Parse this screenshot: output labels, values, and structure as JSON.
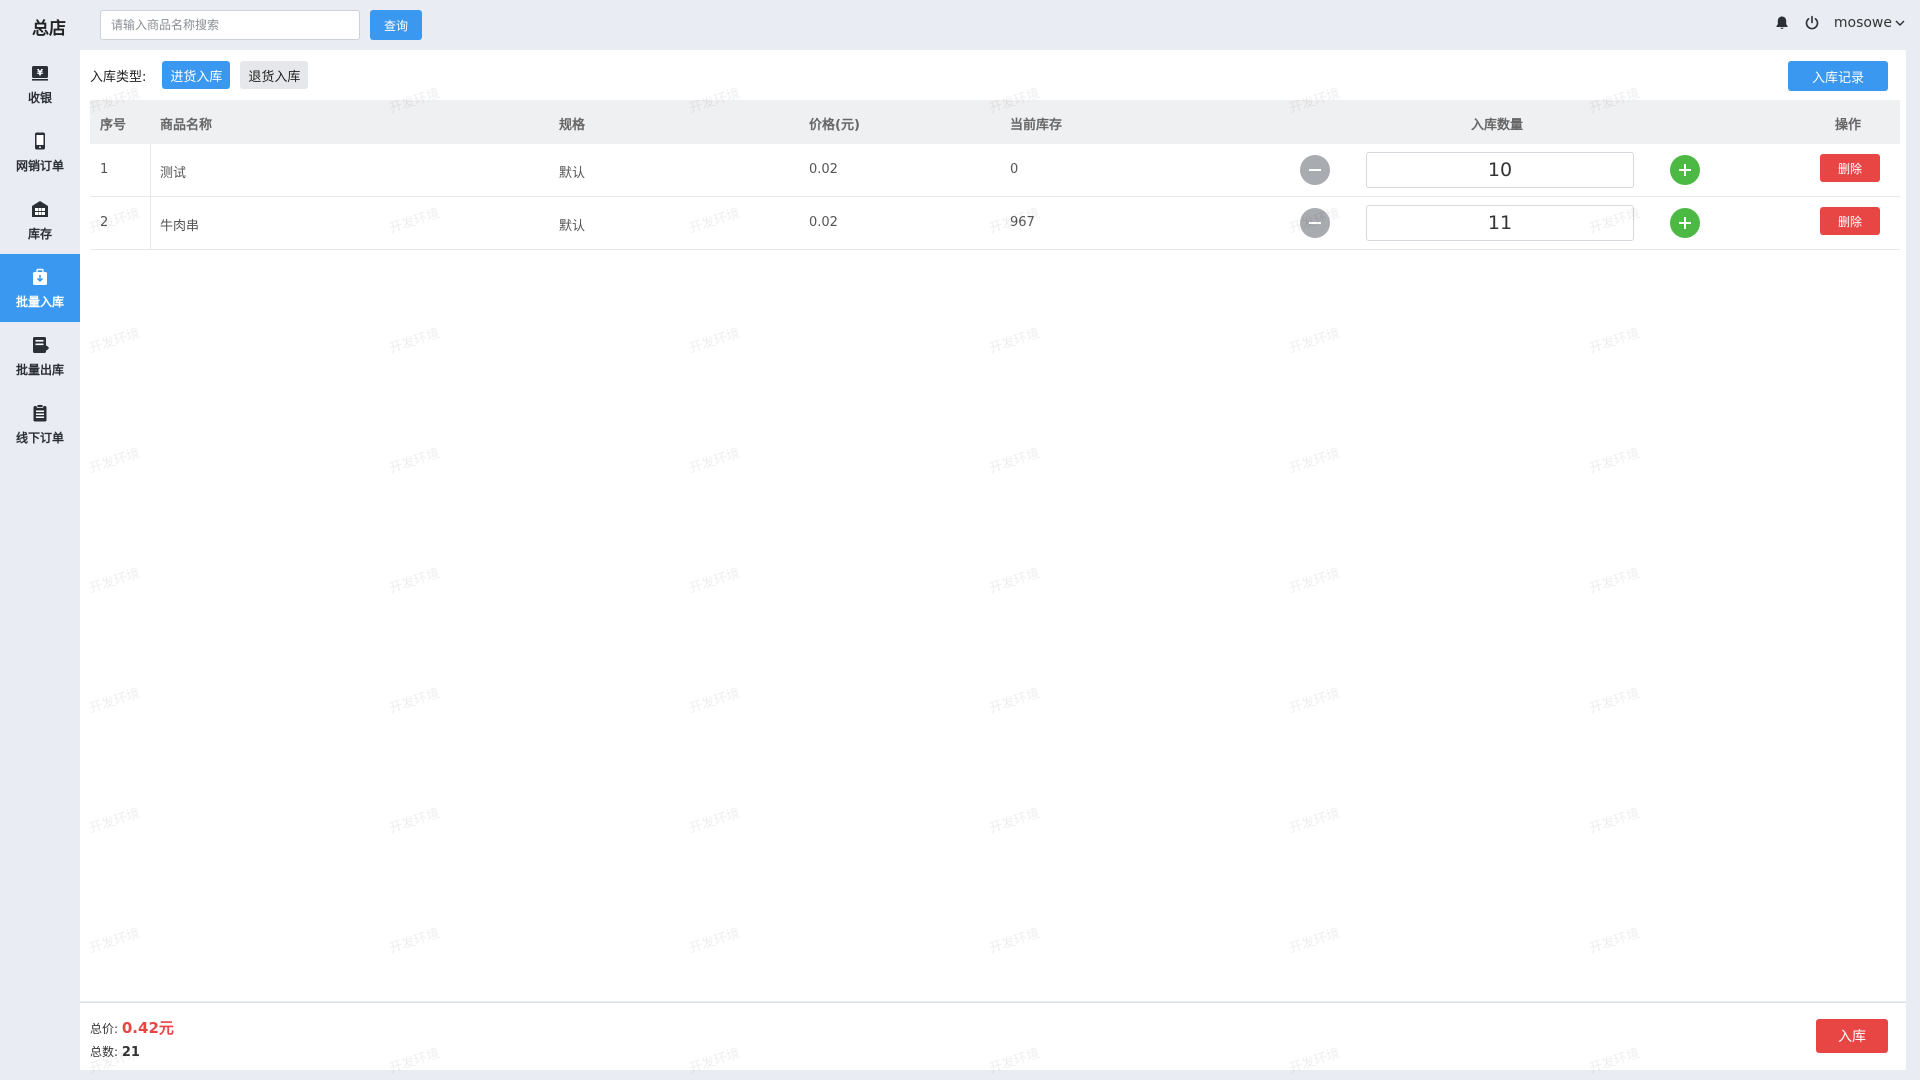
{
  "header": {
    "store_name": "总店",
    "search_placeholder": "请输入商品名称搜索",
    "search_button": "查询",
    "username": "mosowe"
  },
  "sidebar": {
    "items": [
      {
        "label": "收银",
        "icon": "yen-icon"
      },
      {
        "label": "网销订单",
        "icon": "phone-icon"
      },
      {
        "label": "库存",
        "icon": "warehouse-icon"
      },
      {
        "label": "批量入库",
        "icon": "box-in-icon",
        "active": true
      },
      {
        "label": "批量出库",
        "icon": "box-out-icon"
      },
      {
        "label": "线下订单",
        "icon": "clipboard-icon"
      }
    ]
  },
  "toolbar": {
    "type_label": "入库类型:",
    "type_purchase": "进货入库",
    "type_return": "退货入库",
    "record_button": "入库记录"
  },
  "table": {
    "columns": [
      "序号",
      "商品名称",
      "规格",
      "价格(元)",
      "当前库存",
      "入库数量",
      "操作"
    ],
    "rows": [
      {
        "index": "1",
        "name": "测试",
        "spec": "默认",
        "price": "0.02",
        "stock": "0",
        "quantity": "10",
        "action": "删除"
      },
      {
        "index": "2",
        "name": "牛肉串",
        "spec": "默认",
        "price": "0.02",
        "stock": "967",
        "quantity": "11",
        "action": "删除"
      }
    ]
  },
  "footer": {
    "total_price_label": "总价:",
    "total_price_value": "0.42元",
    "total_count_label": "总数:",
    "total_count_value": "21",
    "submit_button": "入库"
  },
  "watermark": "开发环境",
  "colors": {
    "primary": "#3a98f0",
    "danger": "#e84545",
    "success": "#4cb944",
    "background": "#e9edf3"
  }
}
